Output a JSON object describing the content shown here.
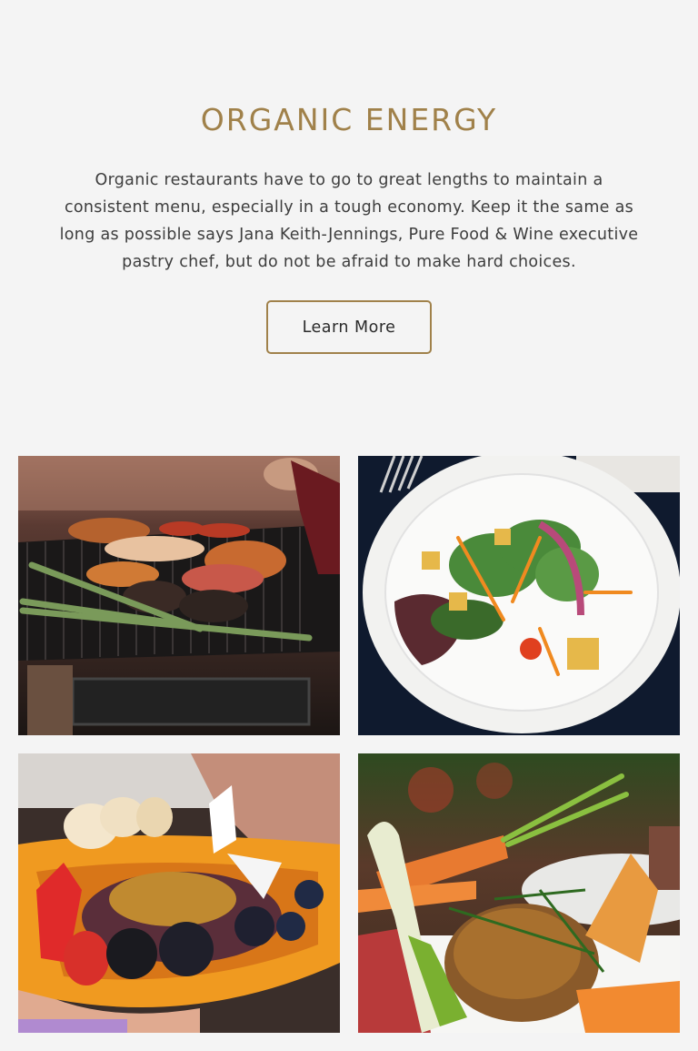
{
  "section": {
    "title": "ORGANIC ENERGY",
    "description": "Organic restaurants have to go to great lengths to maintain a consistent menu, especially in a tough economy. Keep it the same as long as possible says Jana Keith-Jennings, Pure Food & Wine executive pastry chef, but do not be afraid to make hard choices.",
    "cta_label": "Learn More"
  },
  "colors": {
    "accent": "#a0814a",
    "background": "#f4f4f4",
    "text": "#3d3d3d"
  },
  "gallery": [
    {
      "subject": "grill-with-meats-and-asparagus"
    },
    {
      "subject": "salad-on-white-plate"
    },
    {
      "subject": "papaya-with-berries-and-seeds"
    },
    {
      "subject": "plated-dish-with-carrots-and-greens"
    }
  ]
}
